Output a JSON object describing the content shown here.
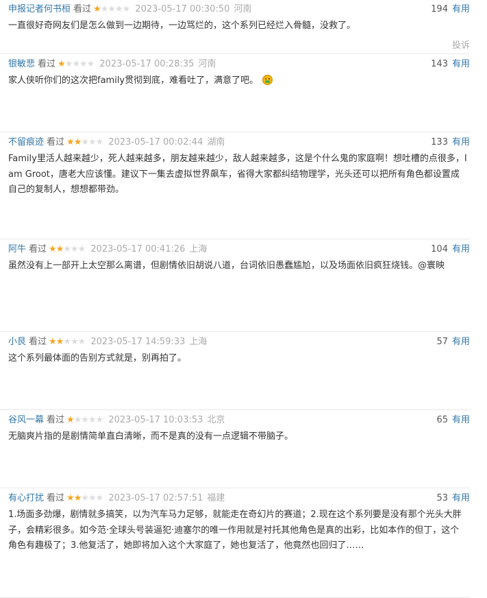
{
  "colors": {
    "user_link": "#3377aa",
    "star_on": "#f5a623",
    "star_off": "#dddddd",
    "meta_gray": "#aaaaaa"
  },
  "comments": [
    {
      "user": "申报记者何书桓",
      "status": "看过",
      "rating": 1,
      "time": "2023-05-17 00:30:50",
      "location": "河南",
      "votes": "194",
      "useful_label": "有用",
      "content": "一直很好奇网友们是怎么做到一边期待，一边骂烂的，这个系列已经烂入骨髓，没救了。",
      "report_label": "投诉"
    },
    {
      "user": "银敏悲",
      "status": "看过",
      "rating": 1,
      "time": "2023-05-17 00:28:35",
      "location": "河南",
      "votes": "143",
      "useful_label": "有用",
      "content": "家人侠听你们的这次把family贯彻到底，难看吐了，满意了吧。",
      "emoji": "vomiting-face"
    },
    {
      "user": "不留痕迹",
      "status": "看过",
      "rating": 2,
      "time": "2023-05-17 00:02:44",
      "location": "湖南",
      "votes": "133",
      "useful_label": "有用",
      "content": "Family里活人越来越少，死人越来越多，朋友越来越少，敌人越来越多，这是个什么鬼的家庭啊！想吐槽的点很多，I am Groot，唐老大应该懂。建议下一集去虚拟世界飙车，省得大家都纠结物理学，光头还可以把所有角色都设置成自己的复制人，想想都带劲。"
    },
    {
      "user": "阿牛",
      "status": "看过",
      "rating": 2,
      "time": "2023-05-17 00:41:26",
      "location": "上海",
      "votes": "104",
      "useful_label": "有用",
      "content": "虽然没有上一部开上太空那么离谱，但剧情依旧胡说八道，台词依旧愚蠢尴尬，以及场面依旧疯狂烧钱。@寰映"
    },
    {
      "user": "小艮",
      "status": "看过",
      "rating": 2,
      "time": "2023-05-17 14:59:33",
      "location": "上海",
      "votes": "57",
      "useful_label": "有用",
      "content": "这个系列最体面的告别方式就是，别再拍了。"
    },
    {
      "user": "谷风一幕",
      "status": "看过",
      "rating": 1,
      "time": "2023-05-17 10:03:53",
      "location": "北京",
      "votes": "65",
      "useful_label": "有用",
      "content": "无脑爽片指的是剧情简单直白清晰，而不是真的没有一点逻辑不带脑子。"
    },
    {
      "user": "有心打扰",
      "status": "看过",
      "rating": 2,
      "time": "2023-05-17 02:57:51",
      "location": "福建",
      "votes": "53",
      "useful_label": "有用",
      "content": "1.场面多劲爆，剧情就多搞笑，以为汽车马力足够，就能走在奇幻片的赛道；2.现在这个系列要是没有那个光头大胖子，会精彩很多。如今范·全球头号装逼犯·迪塞尔的唯一作用就是衬托其他角色是真的出彩，比如本作的但丁，这个角色有趣极了；3.他复活了，她即将加入这个大家庭了，她也复活了，他竟然也回归了……"
    }
  ]
}
